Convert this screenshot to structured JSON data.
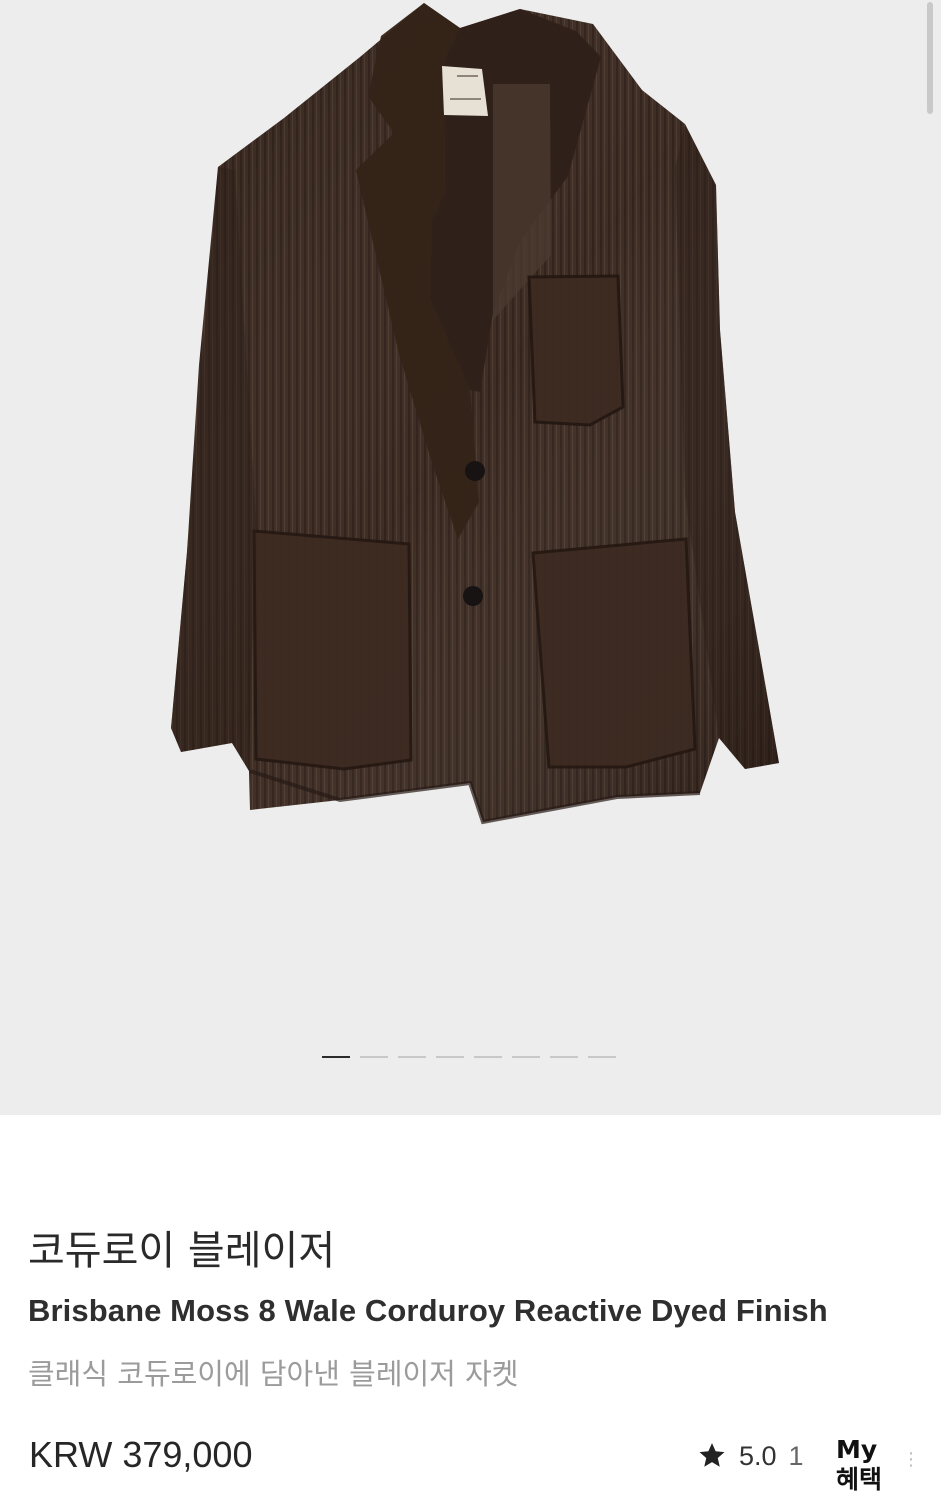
{
  "product": {
    "title_ko": "코듀로이 블레이저",
    "title_en": "Brisbane Moss 8 Wale Corduroy Reactive Dyed Finish",
    "subtitle": "클래식 코듀로이에 담아낸 블레이저 자켓",
    "price": "KRW 379,000",
    "rating": "5.0",
    "rating_count_partial": "1",
    "benefits_label": "My\n혜택"
  },
  "gallery": {
    "image_count": 8,
    "active_index": 1,
    "image_subject": "dark brown corduroy blazer"
  },
  "colors": {
    "background": "#ffffff",
    "gallery_background": "#ededed",
    "jacket": "#3b2a22",
    "text_primary": "#2a2a2a",
    "text_secondary": "#9b9b9b",
    "active_indicator": "#2c2c2c",
    "inactive_indicator": "#c8c8c8"
  },
  "icons": {
    "rating": "star-icon",
    "vertical_scroll": "scrollbar"
  }
}
